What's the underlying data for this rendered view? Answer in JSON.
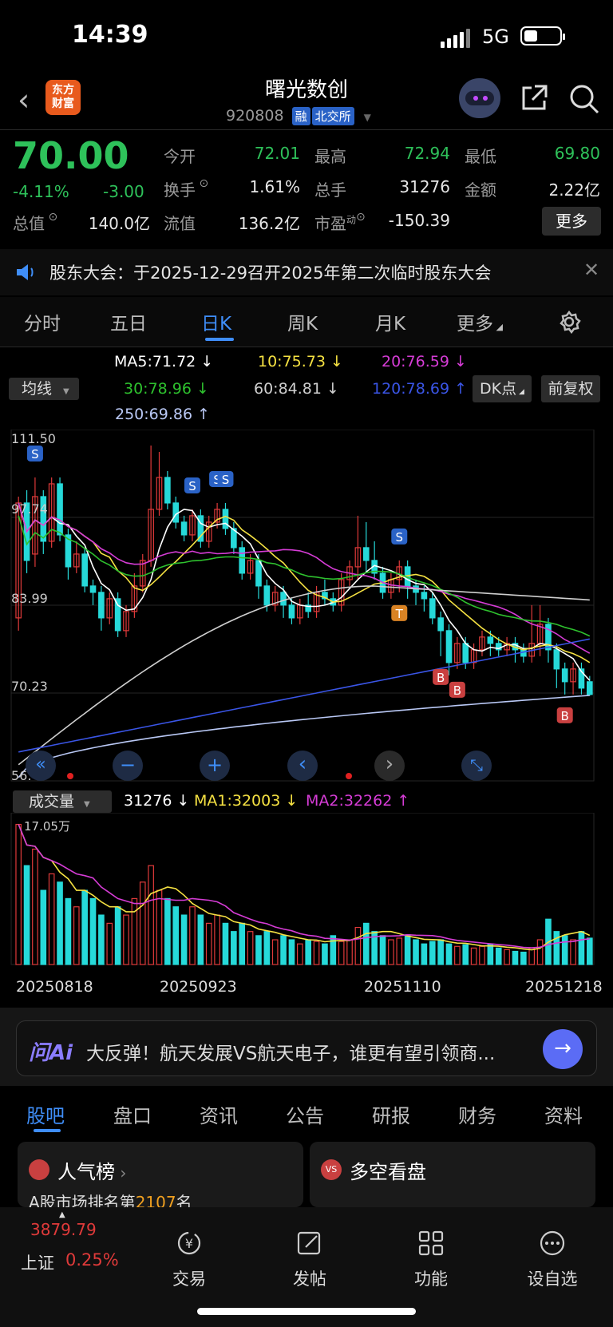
{
  "status_bar": {
    "time": "14:39",
    "network": "5G"
  },
  "header": {
    "logo_text_1": "东方",
    "logo_text_2": "财富",
    "stock_name": "曙光数创",
    "stock_code": "920808",
    "tag_margin": "融",
    "tag_exchange": "北交所"
  },
  "quote": {
    "price": "70.00",
    "change_pct": "-4.11%",
    "change": "-3.00",
    "open_label": "今开",
    "open": "72.01",
    "high_label": "最高",
    "high": "72.94",
    "low_label": "最低",
    "low": "69.80",
    "turnover_label": "换手",
    "turnover": "1.61%",
    "volume_label": "总手",
    "volume": "31276",
    "amount_label": "金额",
    "amount": "2.22亿",
    "mcap_label": "总值",
    "mcap": "140.0亿",
    "float_label": "流值",
    "float": "136.2亿",
    "pe_label": "市盈",
    "pe_sup": "动",
    "pe": "-150.39",
    "more_label": "更多"
  },
  "notice": {
    "text": "股东大会：于2025-12-29召开2025年第二次临时股东大会"
  },
  "chart_tabs": [
    "分时",
    "五日",
    "日K",
    "周K",
    "月K",
    "更多"
  ],
  "active_chart_tab": "日K",
  "ma_bar": {
    "selector": "均线",
    "ma5": "MA5:71.72 ↓",
    "ma10": "10:75.73 ↓",
    "ma20": "20:76.59 ↓",
    "ma30": "30:78.96 ↓",
    "ma60": "60:84.81 ↓",
    "ma120": "120:78.69 ↑",
    "ma250": "250:69.86 ↑",
    "dk_button": "DK点",
    "adjust_button": "前复权"
  },
  "colors": {
    "up": "#e03a3a",
    "down": "#26d9d9",
    "ma5": "#ffffff",
    "ma10": "#f5e142",
    "ma20": "#d63cd6",
    "ma30": "#2ec12e",
    "ma60": "#cfcfcf",
    "ma120": "#3a55e6",
    "ma250": "#b9c8f5",
    "accent": "#3f8ef8"
  },
  "chart_data": {
    "type": "candlestick",
    "ylim": [
      56.47,
      111.5
    ],
    "y_ticks": [
      "111.50",
      "97.74",
      "83.99",
      "70.23",
      "56.47"
    ],
    "x_ticks": [
      "20250818",
      "20250923",
      "20251110",
      "20251218"
    ],
    "candles": [
      [
        82,
        100,
        80,
        101
      ],
      [
        100,
        91,
        89,
        102
      ],
      [
        92,
        101,
        90,
        104
      ],
      [
        101,
        94,
        92,
        102
      ],
      [
        94,
        103,
        93,
        104
      ],
      [
        103,
        95,
        94,
        104
      ],
      [
        95,
        90,
        88,
        96
      ],
      [
        90,
        92,
        89,
        94
      ],
      [
        92,
        87,
        86,
        93
      ],
      [
        87,
        86,
        84,
        88
      ],
      [
        86,
        82,
        80,
        87
      ],
      [
        82,
        85,
        81,
        86
      ],
      [
        85,
        80,
        79,
        86
      ],
      [
        80,
        83,
        79,
        84
      ],
      [
        83,
        87,
        82,
        89
      ],
      [
        87,
        91,
        86,
        92
      ],
      [
        91,
        99,
        90,
        109
      ],
      [
        99,
        104,
        98,
        108
      ],
      [
        104,
        100,
        99,
        105
      ],
      [
        100,
        97,
        96,
        101
      ],
      [
        97,
        95,
        94,
        98
      ],
      [
        95,
        98,
        94,
        99
      ],
      [
        98,
        94,
        93,
        99
      ],
      [
        94,
        97,
        93,
        98
      ],
      [
        97,
        99,
        96,
        100
      ],
      [
        99,
        96,
        95,
        100
      ],
      [
        96,
        93,
        92,
        97
      ],
      [
        93,
        89,
        88,
        94
      ],
      [
        89,
        91,
        88,
        92
      ],
      [
        91,
        87,
        85,
        92
      ],
      [
        87,
        84,
        83,
        88
      ],
      [
        84,
        86,
        83,
        87
      ],
      [
        86,
        84,
        82,
        87
      ],
      [
        84,
        82,
        81,
        85
      ],
      [
        82,
        84,
        81,
        85
      ],
      [
        84,
        83,
        82,
        86
      ],
      [
        83,
        86,
        82,
        87
      ],
      [
        86,
        85,
        84,
        88
      ],
      [
        85,
        84,
        83,
        86
      ],
      [
        84,
        88,
        83,
        89
      ],
      [
        88,
        90,
        87,
        91
      ],
      [
        90,
        93,
        88,
        98
      ],
      [
        93,
        91,
        89,
        97
      ],
      [
        91,
        89,
        88,
        94
      ],
      [
        89,
        86,
        85,
        90
      ],
      [
        86,
        88,
        85,
        89
      ],
      [
        88,
        90,
        86,
        91
      ],
      [
        90,
        87,
        85,
        91
      ],
      [
        87,
        86,
        84,
        88
      ],
      [
        86,
        85,
        83,
        87
      ],
      [
        85,
        82,
        81,
        86
      ],
      [
        82,
        80,
        76,
        83
      ],
      [
        80,
        75,
        73,
        81
      ],
      [
        75,
        78,
        74,
        79
      ],
      [
        78,
        75,
        74,
        79
      ],
      [
        75,
        77,
        74,
        78
      ],
      [
        77,
        79,
        76,
        80
      ],
      [
        79,
        78,
        76,
        80
      ],
      [
        78,
        77,
        76,
        79
      ],
      [
        77,
        78,
        76,
        79
      ],
      [
        78,
        77,
        75,
        79
      ],
      [
        77,
        76,
        75,
        78
      ],
      [
        76,
        78,
        75,
        84
      ],
      [
        78,
        81,
        76,
        84
      ],
      [
        81,
        77,
        75,
        82
      ],
      [
        77,
        74,
        71,
        78
      ],
      [
        74,
        72,
        70,
        75
      ],
      [
        72,
        74,
        70,
        75
      ],
      [
        74,
        71,
        70,
        75
      ],
      [
        72,
        70,
        69.8,
        72.9
      ]
    ],
    "volume": {
      "label": "成交量",
      "ylim": [
        0,
        17.05
      ],
      "max_label": "17.05万",
      "current": "31276 ↓",
      "ma1": "MA1:32003 ↓",
      "ma2": "MA2:32262 ↑",
      "values": [
        17,
        12,
        14,
        9,
        11,
        10,
        8,
        7,
        9,
        8,
        6,
        5,
        7,
        6,
        8,
        10,
        12,
        9,
        8,
        7,
        6,
        7,
        6,
        5,
        6,
        5,
        4,
        5,
        4,
        3.5,
        4,
        3,
        3.5,
        3,
        2.5,
        3,
        2.8,
        2.5,
        3.5,
        2.8,
        3,
        4.5,
        5,
        4,
        3.5,
        3,
        3.2,
        3.6,
        3,
        2.5,
        2.8,
        3,
        2.5,
        2.2,
        2.4,
        2,
        2.2,
        2.5,
        2,
        1.8,
        1.6,
        1.5,
        2,
        3,
        5.5,
        4,
        3.5,
        3,
        4,
        3.2
      ]
    },
    "signals": {
      "S": 6,
      "T": 1,
      "B": 4
    }
  },
  "chart_controls": [
    "«",
    "−",
    "+",
    "‹",
    "›",
    "⤡"
  ],
  "ai": {
    "logo": "问Ai",
    "text": "大反弹！航天发展VS航天电子，谁更有望引领商..."
  },
  "sub_tabs": [
    "股吧",
    "盘口",
    "资讯",
    "公告",
    "研报",
    "财务",
    "资料"
  ],
  "cards": {
    "popularity_title": "人气榜",
    "popularity_sub_prefix": "A股市场排名第",
    "popularity_rank": "2107",
    "popularity_sub_suffix": "名",
    "duokong_title": "多空看盘"
  },
  "bottom_nav": {
    "index_value": "3879.79",
    "index_name": "上证",
    "index_change": "0.25%",
    "trade": "交易",
    "post": "发帖",
    "function": "功能",
    "watchlist": "设自选"
  }
}
